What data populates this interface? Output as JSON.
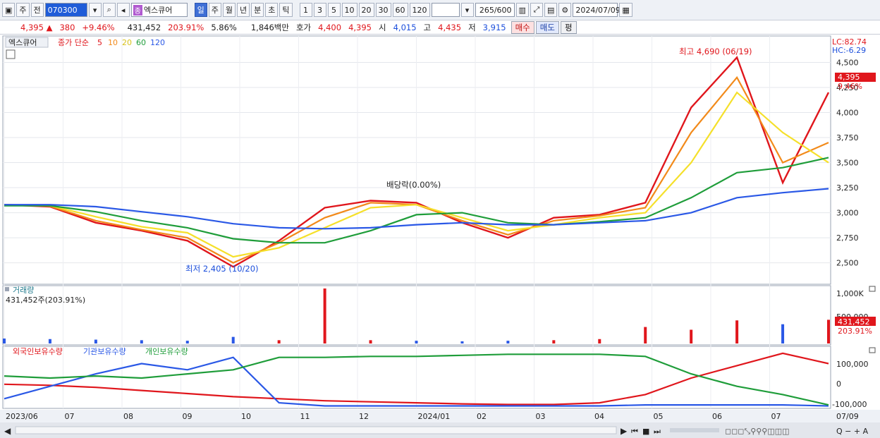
{
  "toolbar": {
    "type_label": "주",
    "prev_label": "전",
    "code": "070300",
    "name_badge": "종",
    "name": "엑스큐어",
    "periods": [
      "일",
      "주",
      "월",
      "년",
      "분",
      "초",
      "틱"
    ],
    "active_period": "일",
    "intervals": [
      "1",
      "3",
      "5",
      "10",
      "20",
      "30",
      "60",
      "120"
    ],
    "count": "265",
    "count_total": "/600",
    "date": "2024/07/09"
  },
  "quote": {
    "price": "4,395",
    "arrow": "▲",
    "change": "380",
    "change_pct": "+9.46%",
    "volume": "431,452",
    "vol_ratio": "203.91%",
    "turnover": "5.86%",
    "amount": "1,846백만",
    "bid_label": "호가",
    "bid1": "4,400",
    "bid2": "4,395",
    "open_label": "시",
    "open": "4,015",
    "high_label": "고",
    "high": "4,435",
    "low_label": "저",
    "low": "3,915",
    "buy_label": "매수",
    "sell_label": "매도",
    "eval_label": "평"
  },
  "price_panel": {
    "title": "엑스큐어",
    "ma_label": "종가 단순",
    "ma_periods": [
      "5",
      "10",
      "20",
      "60",
      "120"
    ],
    "ma_colors": [
      "#e0161c",
      "#f28a1a",
      "#f5e02a",
      "#1f9d3a",
      "#2a58e6"
    ],
    "high_annotation": "최고 4,690 (06/19)",
    "low_annotation": "최저 2,405 (10/20)",
    "dividend_annotation": "배당락(0.00%)",
    "lc": "LC:82.74",
    "hc": "HC:-6.29",
    "current_price": "4,395",
    "current_pct": "9.46%",
    "y_ticks": [
      "4,500",
      "4,250",
      "4,000",
      "3,750",
      "3,500",
      "3,250",
      "3,000",
      "2,750",
      "2,500"
    ]
  },
  "volume_panel": {
    "title": "거래량",
    "value": "431,452주(203.91%)",
    "y_ticks": [
      "1,000K",
      "500,000"
    ],
    "current": "431,452",
    "current_pct": "203.91%"
  },
  "holdings_panel": {
    "series_labels": [
      "외국인보유수량",
      "기관보유수량",
      "개인보유수량"
    ],
    "series_colors": [
      "#e0161c",
      "#2a58e6",
      "#1f9d3a"
    ],
    "y_ticks": [
      "100,000",
      "0",
      "-100,000"
    ]
  },
  "x_axis": {
    "labels": [
      "2023/06",
      "07",
      "08",
      "09",
      "10",
      "11",
      "12",
      "2024/01",
      "02",
      "03",
      "04",
      "05",
      "06",
      "07"
    ],
    "right_label": "07/09"
  },
  "chart_data": {
    "type": "line",
    "title": "엑스큐어",
    "ylim": [
      2300,
      4750
    ],
    "x": [
      "2023/06",
      "2023/07",
      "2023/08",
      "2023/09",
      "2023/10",
      "2023/10/20",
      "2023/11",
      "2023/11/20",
      "2023/12",
      "2024/01",
      "2024/02",
      "2024/03",
      "2024/04",
      "2024/05",
      "2024/05/20",
      "2024/06",
      "2024/06/19",
      "2024/07",
      "2024/07/09"
    ],
    "series": [
      {
        "name": "5",
        "values": [
          3080,
          3060,
          2900,
          2820,
          2720,
          2460,
          2720,
          3050,
          3120,
          3100,
          2900,
          2750,
          2950,
          2980,
          3100,
          4050,
          4550,
          3300,
          4200
        ]
      },
      {
        "name": "10",
        "values": [
          3080,
          3065,
          2920,
          2830,
          2750,
          2500,
          2700,
          2950,
          3100,
          3080,
          2920,
          2780,
          2920,
          2970,
          3050,
          3800,
          4350,
          3500,
          3700
        ]
      },
      {
        "name": "20",
        "values": [
          3080,
          3070,
          2960,
          2860,
          2800,
          2560,
          2650,
          2850,
          3050,
          3080,
          2950,
          2820,
          2880,
          2950,
          3000,
          3500,
          4200,
          3800,
          3500
        ]
      },
      {
        "name": "60",
        "values": [
          3070,
          3070,
          3010,
          2920,
          2850,
          2740,
          2700,
          2700,
          2820,
          2980,
          3000,
          2900,
          2880,
          2910,
          2950,
          3150,
          3400,
          3450,
          3550
        ]
      },
      {
        "name": "120",
        "values": [
          3080,
          3080,
          3060,
          3010,
          2960,
          2890,
          2850,
          2840,
          2850,
          2880,
          2900,
          2880,
          2880,
          2900,
          2920,
          3000,
          3150,
          3200,
          3240
        ]
      }
    ],
    "volume": [
      90,
      80,
      70,
      60,
      50,
      120,
      60,
      1000,
      60,
      50,
      40,
      50,
      60,
      80,
      300,
      250,
      420,
      350,
      431
    ]
  }
}
